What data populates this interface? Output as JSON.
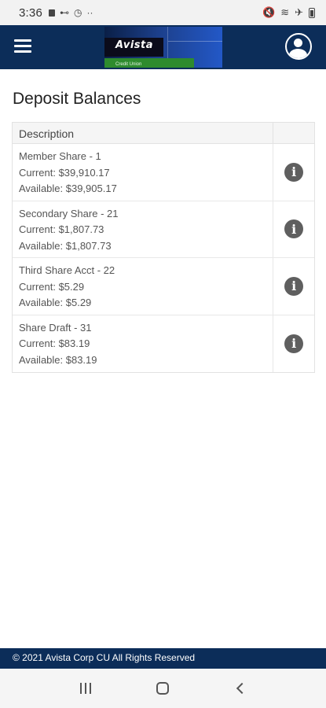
{
  "status_bar": {
    "time": "3:36"
  },
  "header": {
    "logo_text": "Avista",
    "logo_subtext": "Credit Union"
  },
  "page": {
    "title": "Deposit Balances"
  },
  "table": {
    "header": "Description",
    "rows": [
      {
        "name": "Member Share - 1",
        "current": "Current: $39,910.17",
        "available": "Available: $39,905.17"
      },
      {
        "name": "Secondary Share - 21",
        "current": "Current: $1,807.73",
        "available": "Available: $1,807.73"
      },
      {
        "name": "Third Share Acct - 22",
        "current": "Current: $5.29",
        "available": "Available: $5.29"
      },
      {
        "name": "Share Draft - 31",
        "current": "Current: $83.19",
        "available": "Available: $83.19"
      }
    ]
  },
  "footer": {
    "copyright": "© 2021 Avista Corp CU All Rights Reserved"
  },
  "colors": {
    "header_bg": "#0c2d59",
    "info_icon": "#5f5f5f"
  },
  "icons": [
    "menu-icon",
    "profile-icon",
    "info-icon",
    "recents-icon",
    "home-icon",
    "back-icon"
  ]
}
